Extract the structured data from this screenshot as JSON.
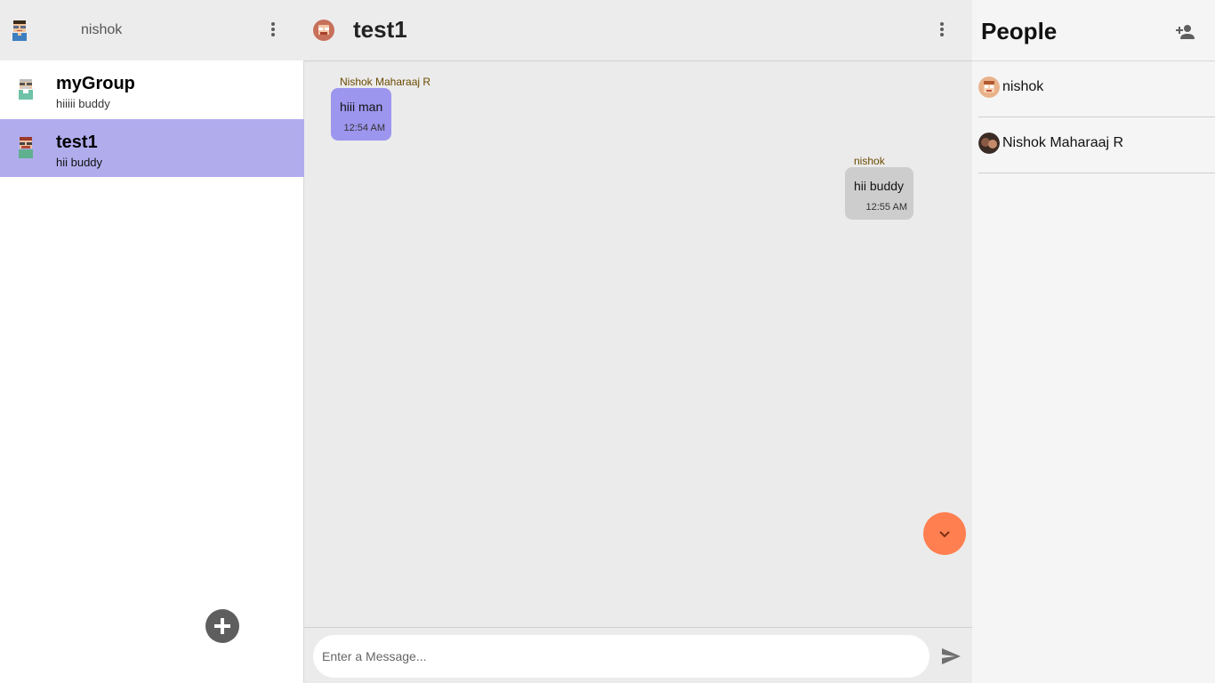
{
  "sidebar": {
    "user": {
      "name": "nishok",
      "avatar_icon": "pixel-avatar-icon"
    },
    "menu_icon": "kebab-menu-icon",
    "chats": [
      {
        "title": "myGroup",
        "preview": "hiiiii buddy",
        "avatar_icon": "pixel-avatar-icon",
        "active": false
      },
      {
        "title": "test1",
        "preview": "hii buddy",
        "avatar_icon": "pixel-avatar-icon",
        "active": true
      }
    ],
    "add_button_icon": "plus-icon"
  },
  "chat": {
    "title": "test1",
    "avatar_icon": "pixel-avatar-icon",
    "menu_icon": "kebab-menu-icon",
    "messages": [
      {
        "sender": "Nishok Maharaaj R",
        "text": "hiii man",
        "time": "12:54 AM",
        "direction": "incoming"
      },
      {
        "sender": "nishok",
        "text": "hii buddy",
        "time": "12:55 AM",
        "direction": "outgoing"
      }
    ],
    "scroll_button_icon": "chevron-down-icon",
    "composer": {
      "placeholder": "Enter a Message...",
      "value": "",
      "send_icon": "send-icon"
    }
  },
  "people": {
    "title": "People",
    "add_icon": "add-person-icon",
    "members": [
      {
        "name": "nishok",
        "avatar_icon": "pixel-avatar-icon"
      },
      {
        "name": "Nishok Maharaaj R",
        "avatar_icon": "photo-avatar-icon"
      }
    ]
  },
  "colors": {
    "active_chat": "#b1aded",
    "incoming_bubble": "#9c96ee",
    "outgoing_bubble": "#cdcdcd",
    "scroll_button": "#ff7f50",
    "sender_name": "#6b4a00"
  }
}
